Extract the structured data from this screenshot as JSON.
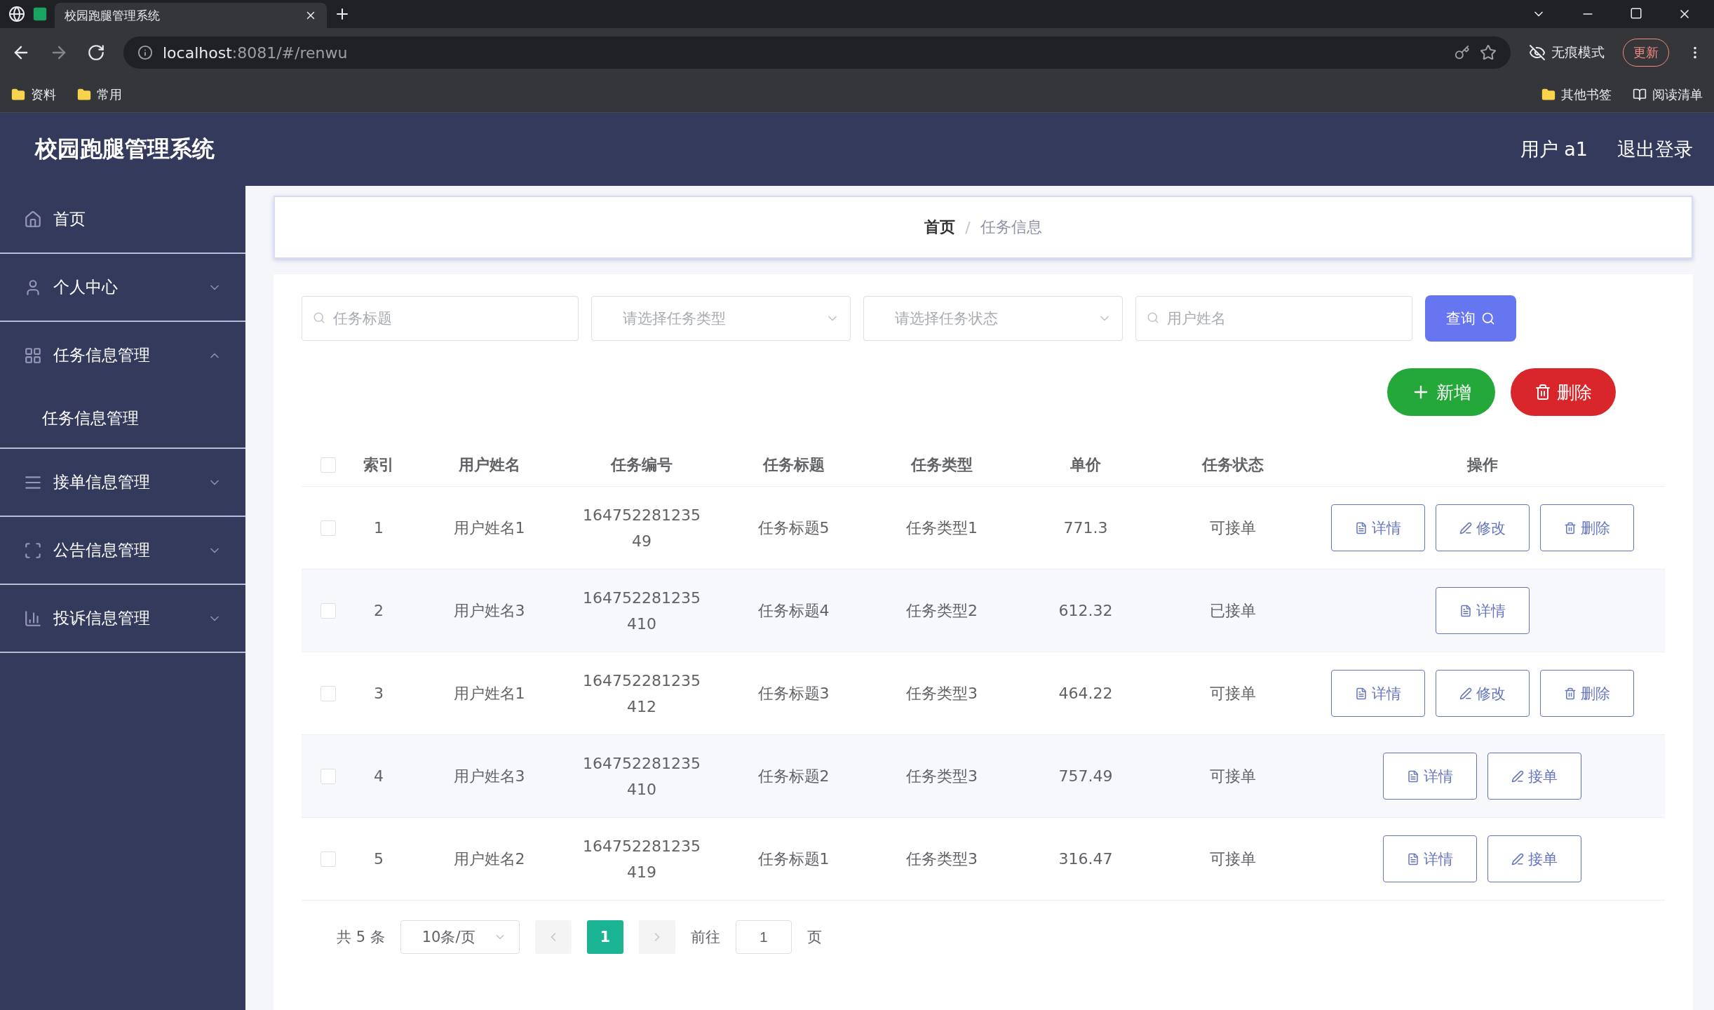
{
  "browser": {
    "tabs": [
      {
        "title": "校园跑腿管理系统",
        "selected": true
      }
    ],
    "url_host": "localhost",
    "url_rest": ":8081/#/renwu",
    "incognito": "无痕模式",
    "update": "更新",
    "bookmarks_left": [
      "资料",
      "常用"
    ],
    "bookmarks_right": [
      {
        "label": "其他书签",
        "kind": "folder"
      },
      {
        "label": "阅读清单",
        "kind": "reading"
      }
    ]
  },
  "header": {
    "title": "校园跑腿管理系统",
    "user": "用户 a1",
    "logout": "退出登录"
  },
  "sidebar": {
    "items": [
      {
        "label": "首页"
      },
      {
        "label": "个人中心",
        "expanded": false
      },
      {
        "label": "任务信息管理",
        "expanded": true,
        "children": [
          {
            "label": "任务信息管理"
          }
        ]
      },
      {
        "label": "接单信息管理",
        "expanded": false
      },
      {
        "label": "公告信息管理",
        "expanded": false
      },
      {
        "label": "投诉信息管理",
        "expanded": false
      }
    ]
  },
  "breadcrumb": [
    "首页",
    "任务信息"
  ],
  "breadcrumb_separator": "/",
  "filters": [
    {
      "kind": "input",
      "placeholder": "任务标题"
    },
    {
      "kind": "select",
      "placeholder": "请选择任务类型"
    },
    {
      "kind": "select",
      "placeholder": "请选择任务状态"
    },
    {
      "kind": "input",
      "placeholder": "用户姓名"
    }
  ],
  "query_button": "查询",
  "actions": [
    {
      "kind": "add",
      "label": "新增"
    },
    {
      "kind": "delete",
      "label": "删除"
    }
  ],
  "table": {
    "select_all_checked": false,
    "columns": [
      "索引",
      "用户姓名",
      "任务编号",
      "任务标题",
      "任务类型",
      "单价",
      "任务状态",
      "操作"
    ],
    "rows": [
      {
        "checked": false,
        "cells": [
          "1",
          "用户姓名1",
          "164752281235 49",
          "任务标题5",
          "任务类型1",
          "771.3",
          "可接单"
        ],
        "buttons": [
          {
            "kind": "detail",
            "label": "详情"
          },
          {
            "kind": "edit",
            "label": "修改"
          },
          {
            "kind": "delete",
            "label": "删除"
          }
        ]
      },
      {
        "checked": false,
        "cells": [
          "2",
          "用户姓名3",
          "164752281235 410",
          "任务标题4",
          "任务类型2",
          "612.32",
          "已接单"
        ],
        "buttons": [
          {
            "kind": "detail",
            "label": "详情"
          }
        ]
      },
      {
        "checked": false,
        "cells": [
          "3",
          "用户姓名1",
          "164752281235 412",
          "任务标题3",
          "任务类型3",
          "464.22",
          "可接单"
        ],
        "buttons": [
          {
            "kind": "detail",
            "label": "详情"
          },
          {
            "kind": "edit",
            "label": "修改"
          },
          {
            "kind": "delete",
            "label": "删除"
          }
        ]
      },
      {
        "checked": false,
        "cells": [
          "4",
          "用户姓名3",
          "164752281235 410",
          "任务标题2",
          "任务类型3",
          "757.49",
          "可接单"
        ],
        "buttons": [
          {
            "kind": "detail",
            "label": "详情"
          },
          {
            "kind": "accept",
            "label": "接单"
          }
        ]
      },
      {
        "checked": false,
        "cells": [
          "5",
          "用户姓名2",
          "164752281235 419",
          "任务标题1",
          "任务类型3",
          "316.47",
          "可接单"
        ],
        "buttons": [
          {
            "kind": "detail",
            "label": "详情"
          },
          {
            "kind": "accept",
            "label": "接单"
          }
        ]
      }
    ]
  },
  "pagination": {
    "total": "共 5 条",
    "page_size": "10条/页",
    "pages": [
      {
        "label": "1",
        "selected": true
      }
    ],
    "goto_label": "前往",
    "goto_value": "1",
    "page_suffix": "页"
  }
}
